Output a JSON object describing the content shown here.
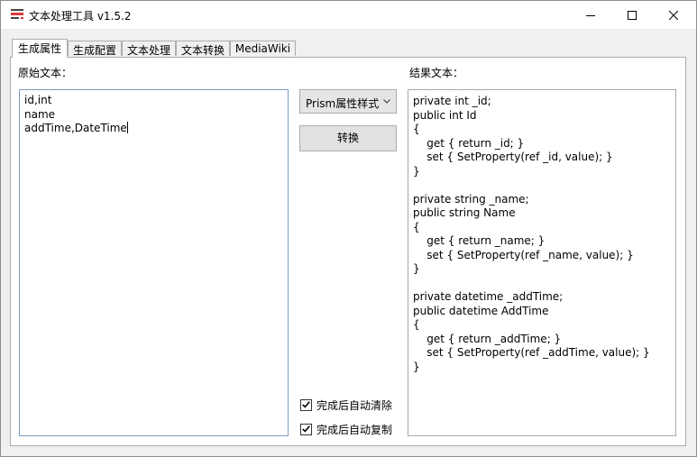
{
  "window": {
    "title": "文本处理工具 v1.5.2"
  },
  "tabs": [
    {
      "label": "生成属性",
      "active": true
    },
    {
      "label": "生成配置",
      "active": false
    },
    {
      "label": "文本处理",
      "active": false
    },
    {
      "label": "文本转换",
      "active": false
    },
    {
      "label": "MediaWiki",
      "active": false
    }
  ],
  "source": {
    "label": "原始文本：",
    "value": "id,int\nname\naddTime,DateTime"
  },
  "result": {
    "label": "结果文本：",
    "value": "private int _id;\npublic int Id\n{\n    get { return _id; }\n    set { SetProperty(ref _id, value); }\n}\n\nprivate string _name;\npublic string Name\n{\n    get { return _name; }\n    set { SetProperty(ref _name, value); }\n}\n\nprivate datetime _addTime;\npublic datetime AddTime\n{\n    get { return _addTime; }\n    set { SetProperty(ref _addTime, value); }\n}"
  },
  "controls": {
    "style_select": "Prism属性样式",
    "convert_button": "转换",
    "auto_clear": {
      "label": "完成后自动清除",
      "checked": true
    },
    "auto_copy": {
      "label": "完成后自动复制",
      "checked": true
    }
  },
  "colors": {
    "accent_border": "#7a9cbf",
    "app_icon_red": "#d83b3b"
  }
}
